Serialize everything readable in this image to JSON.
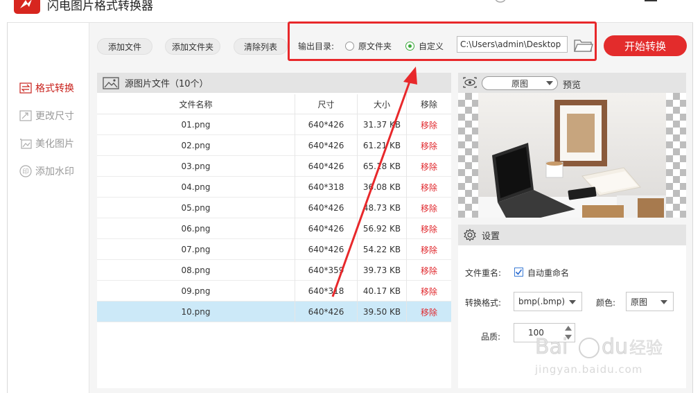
{
  "app": {
    "title": "闪电图片格式转换器"
  },
  "sidebar": {
    "items": [
      {
        "label": "格式转换",
        "icon": "swap-icon",
        "active": true
      },
      {
        "label": "更改尺寸",
        "icon": "resize-icon",
        "active": false
      },
      {
        "label": "美化图片",
        "icon": "beautify-icon",
        "active": false
      },
      {
        "label": "添加水印",
        "icon": "watermark-icon",
        "active": false
      }
    ]
  },
  "toolbar": {
    "add_file": "添加文件",
    "add_folder": "添加文件夹",
    "clear_list": "清除列表",
    "output_label": "输出目录:",
    "radio_original": "原文件夹",
    "radio_custom": "自定义",
    "output_path": "C:\\Users\\admin\\Desktop",
    "start": "开始转换"
  },
  "files": {
    "header": "源图片文件（10个）",
    "columns": {
      "name": "文件名称",
      "size": "尺寸",
      "bytes": "大小",
      "remove": "移除"
    },
    "rows": [
      {
        "name": "01.png",
        "size": "640*426",
        "bytes": "31.37 KB",
        "remove": "移除"
      },
      {
        "name": "02.png",
        "size": "640*426",
        "bytes": "61.21 KB",
        "remove": "移除"
      },
      {
        "name": "03.png",
        "size": "640*426",
        "bytes": "65.18 KB",
        "remove": "移除"
      },
      {
        "name": "04.png",
        "size": "640*318",
        "bytes": "36.08 KB",
        "remove": "移除"
      },
      {
        "name": "05.png",
        "size": "640*426",
        "bytes": "48.73 KB",
        "remove": "移除"
      },
      {
        "name": "06.png",
        "size": "640*426",
        "bytes": "56.92 KB",
        "remove": "移除"
      },
      {
        "name": "07.png",
        "size": "640*426",
        "bytes": "54.22 KB",
        "remove": "移除"
      },
      {
        "name": "08.png",
        "size": "640*359",
        "bytes": "39.73 KB",
        "remove": "移除"
      },
      {
        "name": "09.png",
        "size": "640*318",
        "bytes": "40.17 KB",
        "remove": "移除"
      },
      {
        "name": "10.png",
        "size": "640*426",
        "bytes": "39.50 KB",
        "remove": "移除"
      }
    ]
  },
  "preview": {
    "mode": "原图",
    "label": "预览"
  },
  "settings": {
    "title": "设置",
    "rename_label": "文件重名:",
    "auto_rename": "自动重命名",
    "format_label": "转换格式:",
    "format_value": "bmp(.bmp)",
    "color_label": "颜色:",
    "color_value": "原图",
    "quality_label": "品质:",
    "quality_value": "100"
  },
  "watermark": {
    "brand": "Bai du 经验",
    "url": "jingyan.baidu.com"
  },
  "colors": {
    "accent": "#e32c2c",
    "selected_row": "#cce9f8",
    "annotation": "#e8282b"
  }
}
